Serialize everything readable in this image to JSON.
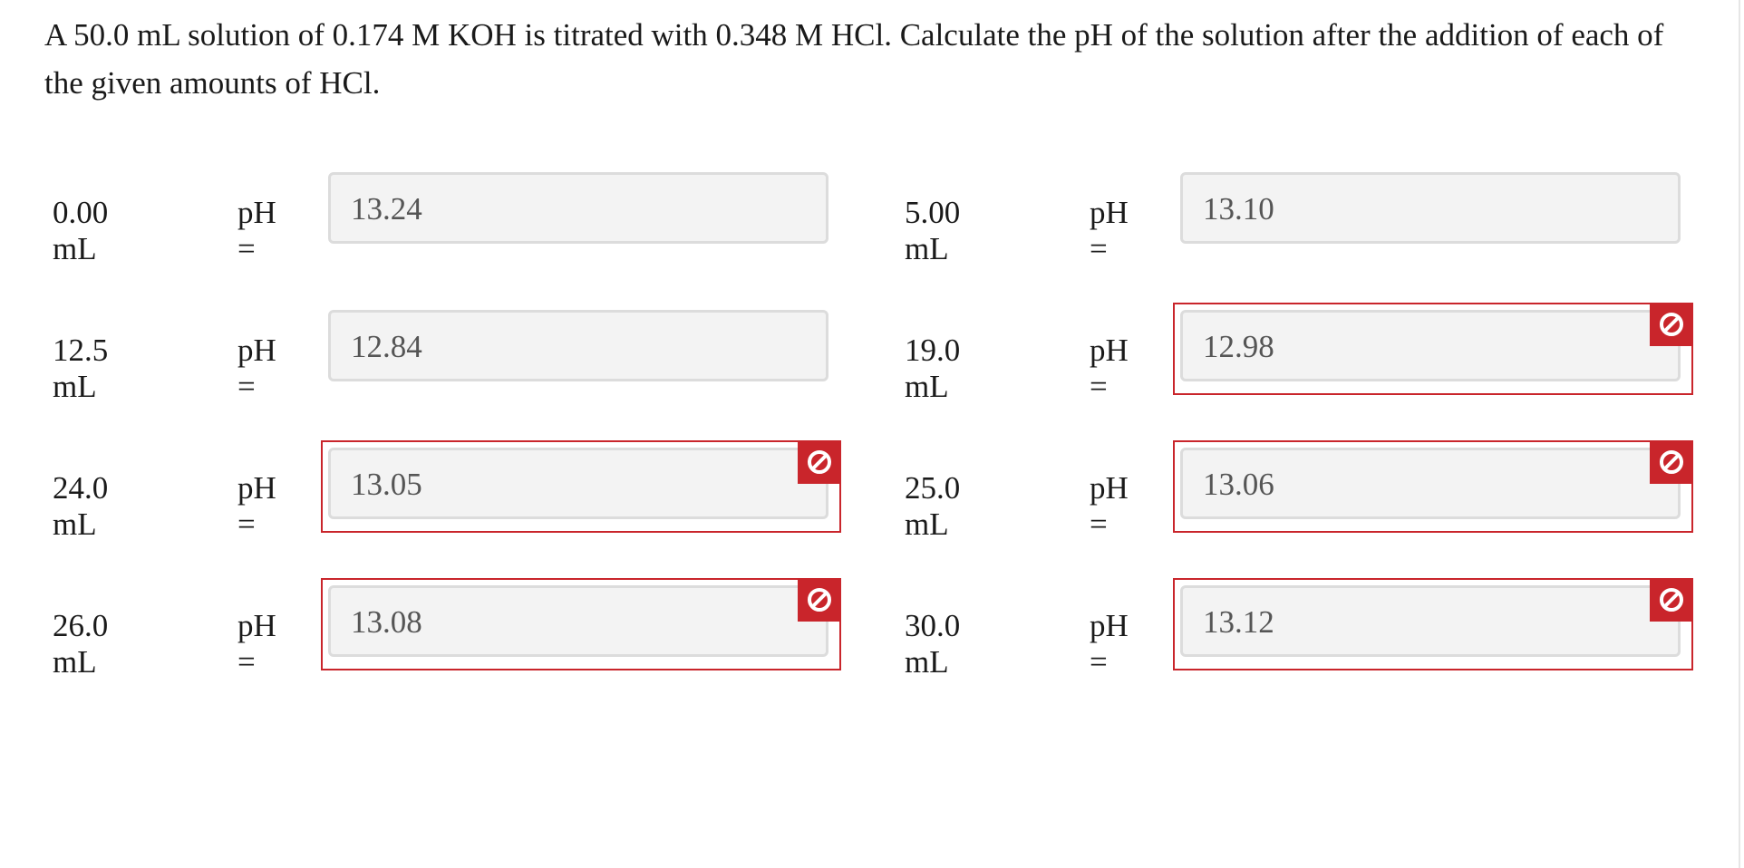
{
  "question": "A 50.0 mL solution of 0.174 M KOH is titrated with 0.348 M HCl. Calculate the pH of the solution after the addition of each of the given amounts of HCl.",
  "ph_label": "pH =",
  "colors": {
    "error": "#c9252b",
    "box_background": "#f3f3f3",
    "box_border": "#dcdcdc"
  },
  "icons": {
    "error_badge": "prohibited-icon"
  },
  "answers": [
    {
      "volume": "0.00 mL",
      "ph": "13.24",
      "status": "neutral"
    },
    {
      "volume": "5.00 mL",
      "ph": "13.10",
      "status": "neutral"
    },
    {
      "volume": "12.5 mL",
      "ph": "12.84",
      "status": "neutral"
    },
    {
      "volume": "19.0 mL",
      "ph": "12.98",
      "status": "incorrect"
    },
    {
      "volume": "24.0 mL",
      "ph": "13.05",
      "status": "incorrect"
    },
    {
      "volume": "25.0 mL",
      "ph": "13.06",
      "status": "incorrect"
    },
    {
      "volume": "26.0 mL",
      "ph": "13.08",
      "status": "incorrect"
    },
    {
      "volume": "30.0 mL",
      "ph": "13.12",
      "status": "incorrect"
    }
  ]
}
